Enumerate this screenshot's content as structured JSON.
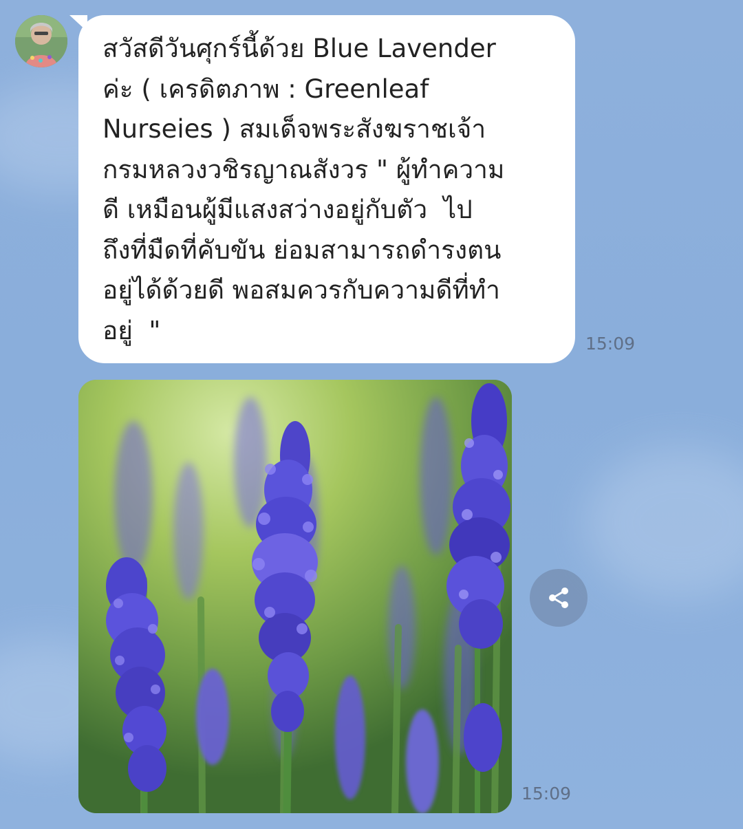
{
  "conversation": {
    "messages": [
      {
        "type": "text",
        "sender_avatar": "profile-avatar",
        "text": "สวัสดีวันศุกร์นี้ด้วย Blue Lavender\nค่ะ ( เครดิตภาพ : Greenleaf\nNurseies ) สมเด็จพระสังฆราชเจ้า\nกรมหลวงวชิรญาณสังวร \" ผู้ทำความ\nดี เหมือนผู้มีแสงสว่างอยู่กับตัว  ไป\nถึงที่มืดที่คับขัน ย่อมสามารถดำรงตน\nอยู่ได้ด้วยดี พอสมควรกับความดีที่ทำ\nอยู่  \"",
        "time": "15:09"
      },
      {
        "type": "image",
        "image_subject": "lavender-photo",
        "time": "15:09",
        "share_icon": "share-icon"
      }
    ]
  },
  "colors": {
    "background": "#8aaedb",
    "bubble": "#ffffff",
    "text": "#222222",
    "time": "#5f6f87"
  }
}
